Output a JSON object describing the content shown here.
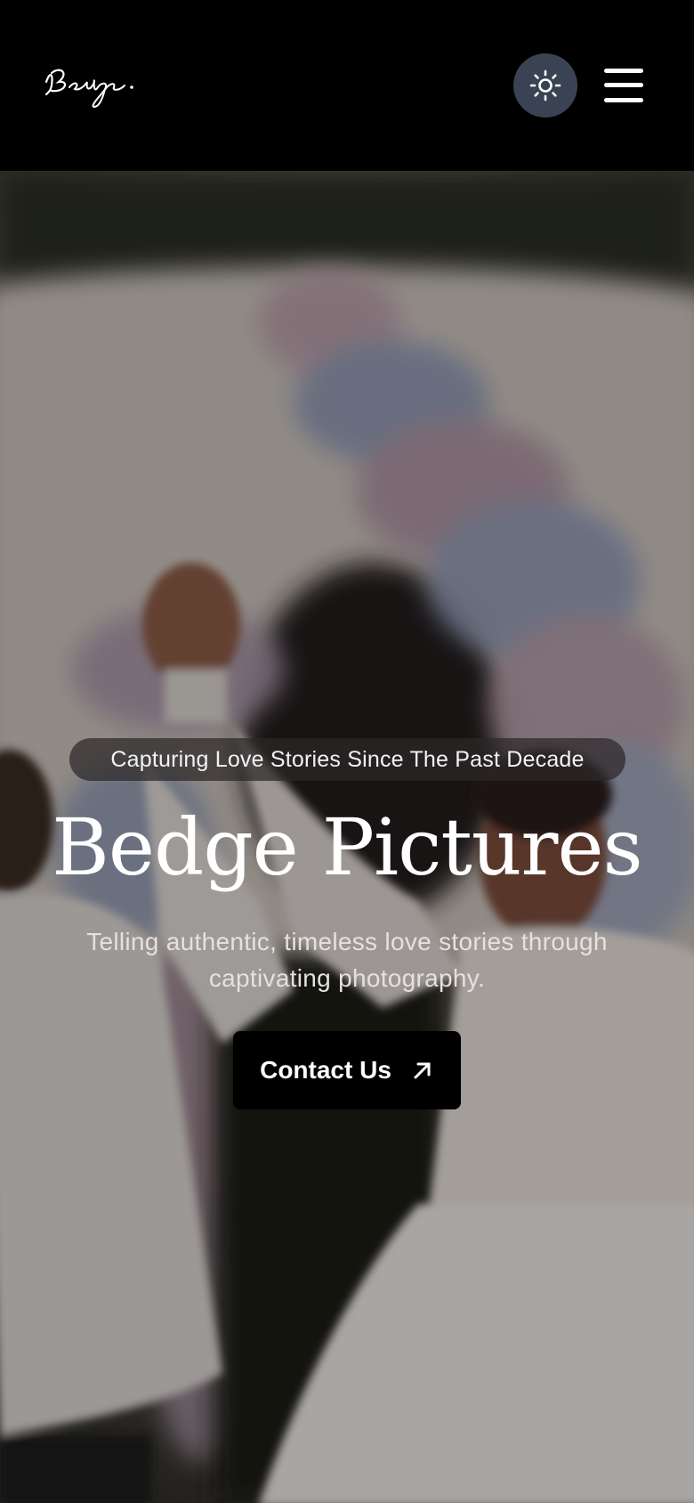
{
  "header": {
    "logo_text": "Bedge.",
    "theme_toggle_icon": "sun-icon",
    "menu_icon": "hamburger-menu-icon"
  },
  "hero": {
    "badge": "Capturing Love Stories Since The Past Decade",
    "title": "Bedge Pictures",
    "subtitle": "Telling authentic, timeless love stories through captivating photography.",
    "cta_label": "Contact Us",
    "cta_icon": "arrow-up-right-icon",
    "image_description": "wedding couple celebrating with raised joined hands in front of floral arch"
  },
  "colors": {
    "header_bg": "#000000",
    "theme_button_bg": "#3a4353",
    "badge_bg": "#2d2828",
    "cta_bg": "#000000",
    "text": "#ffffff"
  }
}
